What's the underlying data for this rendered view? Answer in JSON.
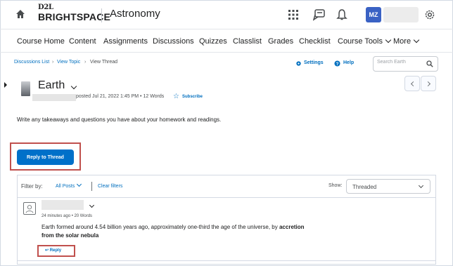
{
  "topbar": {
    "logo_top": "D2L",
    "logo_bottom": "BRIGHTSPACE",
    "course_title": "Astronomy",
    "user_initials": "MZ",
    "icons": [
      "home-icon",
      "apps-grid-icon",
      "message-alert-icon",
      "notification-bell-icon",
      "settings-gear-icon"
    ]
  },
  "nav": {
    "items": [
      "Course Home",
      "Content",
      "Assignments",
      "Discussions",
      "Quizzes",
      "Classlist",
      "Grades",
      "Checklist",
      "Course Tools",
      "More"
    ]
  },
  "breadcrumb": {
    "items": [
      "Discussions List",
      "View Topic",
      "View Thread"
    ]
  },
  "tools": {
    "settings_label": "Settings",
    "help_label": "Help",
    "search_placeholder": "Search Earth"
  },
  "thread": {
    "title": "Earth",
    "meta": "posted Jul 21, 2022 1:45 PM • 12 Words",
    "subscribe_label": "Subscribe",
    "description": "Write any takeaways and questions you have about your homework and readings.",
    "reply_button": "Reply to Thread"
  },
  "filters": {
    "filter_label": "Filter by:",
    "filter_value": "All Posts",
    "clear_label": "Clear filters",
    "show_label": "Show:",
    "show_value": "Threaded"
  },
  "post": {
    "meta": "24 minutes ago • 20 Words",
    "body_plain": "Earth formed around 4.54 billion years ago, approximately one-third the age of the universe, by ",
    "body_bold": "accretion from the solar nebula",
    "reply_label": "Reply"
  },
  "colors": {
    "accent": "#006fbf",
    "button": "#0070c9",
    "highlight": "#c0504d",
    "avatar": "#3a62c4"
  }
}
